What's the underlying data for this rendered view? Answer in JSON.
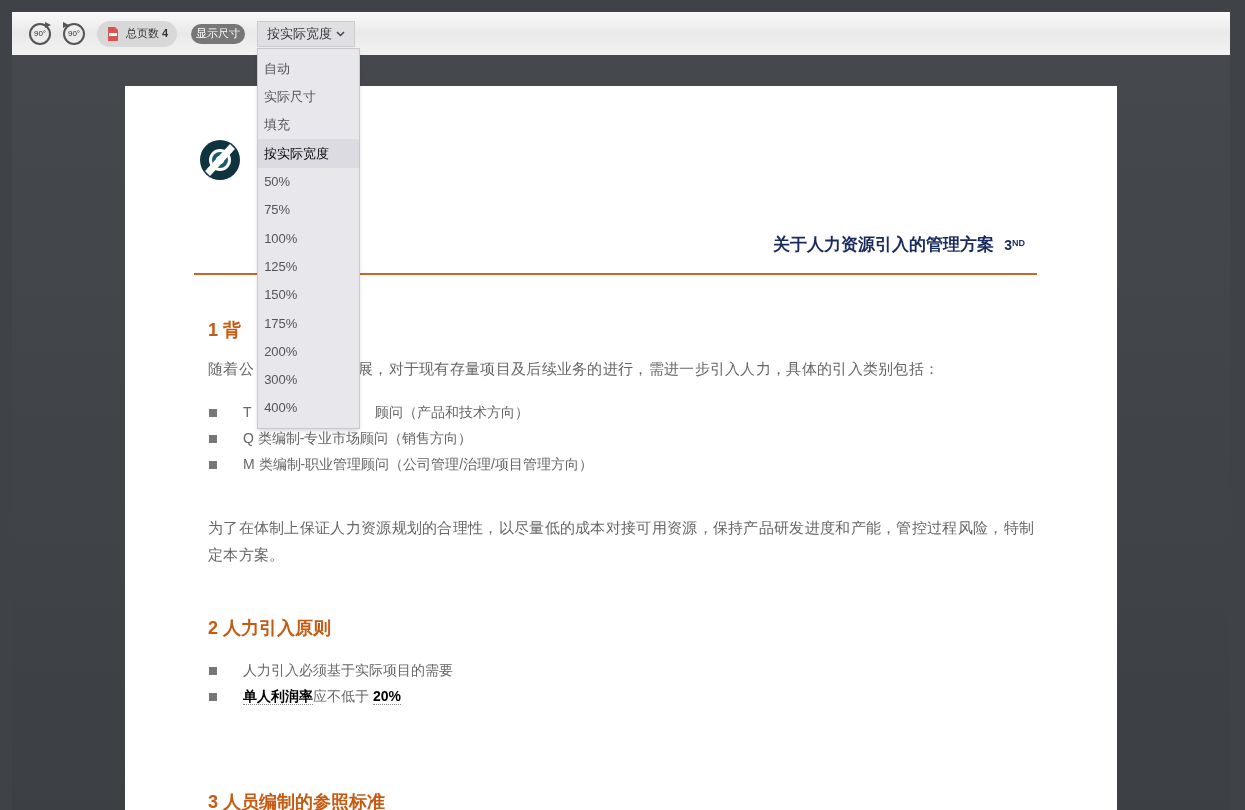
{
  "toolbar": {
    "rotate_buttons": [
      {
        "kind": "left",
        "label": "90°"
      },
      {
        "kind": "right",
        "label": "90°"
      }
    ],
    "page_count": {
      "label": "总页数",
      "value": "4"
    },
    "size_toggle": {
      "label": "显示尺寸",
      "on": false
    },
    "zoom_select": {
      "value": "按实际宽度",
      "expanded": true,
      "options": [
        {
          "label": "自动",
          "selected": false
        },
        {
          "label": "实际尺寸",
          "selected": false
        },
        {
          "label": "填充",
          "selected": false
        },
        {
          "label": "按实际宽度",
          "selected": true
        },
        {
          "label": "50%",
          "selected": false
        },
        {
          "label": "75%",
          "selected": false
        },
        {
          "label": "100%",
          "selected": false
        },
        {
          "label": "125%",
          "selected": false
        },
        {
          "label": "150%",
          "selected": false
        },
        {
          "label": "175%",
          "selected": false
        },
        {
          "label": "200%",
          "selected": false
        },
        {
          "label": "300%",
          "selected": false
        },
        {
          "label": "400%",
          "selected": false
        }
      ]
    }
  },
  "document": {
    "header_title": "关于人力资源引入的管理方案",
    "header_mark": "3$^{ND}$",
    "blocks": [
      {
        "kind": "heading",
        "text": "1 背"
      },
      {
        "kind": "paragraph",
        "parts": [
          "随着公",
          "展，对于现有存量项目及后续业务的进行，需进一步引入人力，具体的引入类别包括："
        ]
      },
      {
        "kind": "bullets",
        "items": [
          {
            "parts": [
              "T",
              "顾问（产品和技术方向）"
            ]
          },
          {
            "parts": [
              "Q 类编制-专业市场顾问（销售方向）"
            ]
          },
          {
            "parts": [
              "M 类编制-职业管理顾问（公司管理/治理/项目管理方向）"
            ]
          }
        ]
      },
      {
        "kind": "paragraph",
        "parts": [
          "为了在体制上保证人力资源规划的合理性，以尽量低的成本对接可用资源，保持产品研发进度和产能，管控过程风险，特制定本方案。"
        ]
      },
      {
        "kind": "heading",
        "text": "2 人力引入原则"
      },
      {
        "kind": "bullets",
        "items": [
          {
            "parts": [
              "人力引入必须基于实际项目的需要"
            ]
          },
          {
            "parts": [
              "**单人利润率**应不低于 **20%**"
            ]
          }
        ]
      },
      {
        "kind": "heading",
        "text": "3 人员编制的参照标准"
      }
    ]
  }
}
